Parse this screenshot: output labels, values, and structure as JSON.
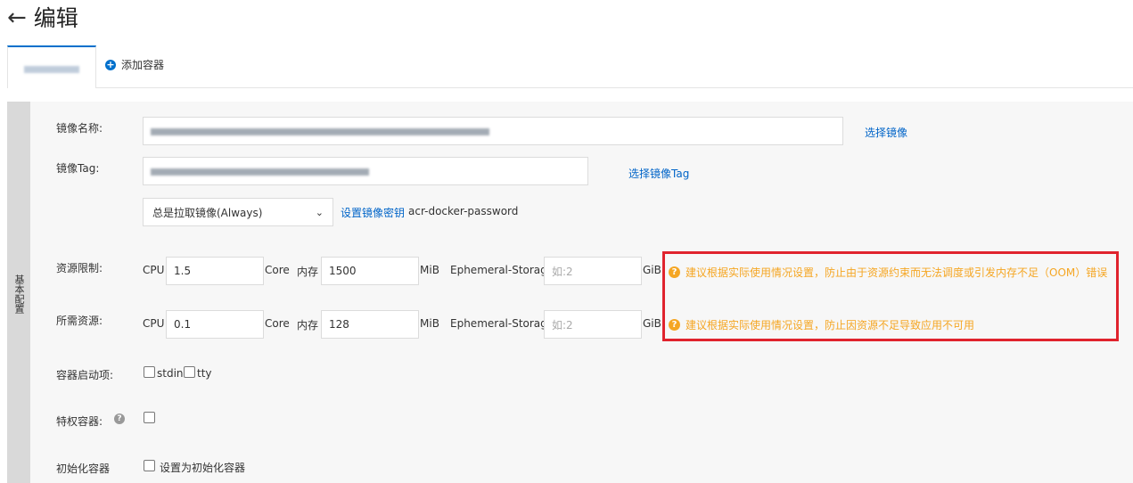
{
  "header": {
    "back_icon": "arrow-left-icon",
    "title": "编辑"
  },
  "tabs": {
    "add_container_label": "添加容器"
  },
  "section": {
    "side_label": "基本配置"
  },
  "image": {
    "name_label": "镜像名称:",
    "select_image_link": "选择镜像",
    "tag_label": "镜像Tag:",
    "select_tag_link": "选择镜像Tag",
    "pull_policy": "总是拉取镜像(Always)",
    "set_secret_link": "设置镜像密钥",
    "secret_name": "acr-docker-password"
  },
  "limits": {
    "label": "资源限制:",
    "cpu_label": "CPU",
    "cpu_value": "1.5",
    "core_unit": "Core",
    "mem_label": "内存",
    "mem_value": "1500",
    "mib_unit": "MiB",
    "storage_label": "Ephemeral-Storage",
    "storage_placeholder": "如:2",
    "gib_unit": "GiB",
    "warning": "建议根据实际使用情况设置，防止由于资源约束而无法调度或引发内存不足（OOM）错误"
  },
  "requests": {
    "label": "所需资源:",
    "cpu_label": "CPU",
    "cpu_value": "0.1",
    "core_unit": "Core",
    "mem_label": "内存",
    "mem_value": "128",
    "mib_unit": "MiB",
    "storage_label": "Ephemeral-Storage",
    "storage_placeholder": "如:2",
    "gib_unit": "GiB",
    "warning": "建议根据实际使用情况设置，防止因资源不足导致应用不可用"
  },
  "startup": {
    "label": "容器启动项:",
    "stdin": "stdin",
    "tty": "tty"
  },
  "privileged": {
    "label": "特权容器:"
  },
  "init": {
    "label": "初始化容器",
    "checkbox_label": "设置为初始化容器"
  },
  "colors": {
    "accent": "#0070cc",
    "link": "#0064c8",
    "warning": "#f5a623",
    "highlight": "#e0232d"
  }
}
